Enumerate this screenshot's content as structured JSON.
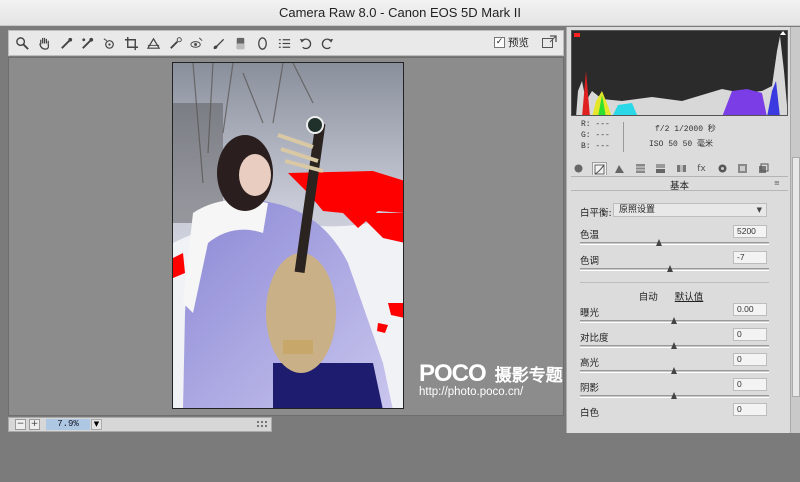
{
  "window": {
    "title": "Camera Raw 8.0 -  Canon EOS 5D Mark II"
  },
  "toolbar": {
    "tools": [
      {
        "name": "zoom-tool-icon"
      },
      {
        "name": "hand-tool-icon"
      },
      {
        "name": "white-balance-tool-icon"
      },
      {
        "name": "color-sampler-icon"
      },
      {
        "name": "targeted-adjustment-icon"
      },
      {
        "name": "crop-tool-icon"
      },
      {
        "name": "straighten-tool-icon"
      },
      {
        "name": "spot-removal-icon"
      },
      {
        "name": "red-eye-icon"
      },
      {
        "name": "adjustment-brush-icon"
      },
      {
        "name": "graduated-filter-icon"
      },
      {
        "name": "radial-filter-icon"
      },
      {
        "name": "preferences-icon"
      },
      {
        "name": "rotate-ccw-icon"
      },
      {
        "name": "rotate-cw-icon"
      }
    ],
    "preview_label": "预览",
    "preview_checked": true
  },
  "watermark": {
    "logo": "POCO",
    "cn_text": "摄影专题",
    "url": "http://photo.poco.cn/"
  },
  "statusbar": {
    "zoom": "7.9%",
    "minus": "−",
    "plus": "+"
  },
  "info": {
    "r": "R:  ---",
    "g": "G:  ---",
    "b": "B:  ---",
    "cam1": "f/2   1/2000 秒",
    "cam2": "ISO 50   50 毫米"
  },
  "tabs": [
    {
      "name": "tab-basic"
    },
    {
      "name": "tab-tone-curve"
    },
    {
      "name": "tab-detail"
    },
    {
      "name": "tab-hsl"
    },
    {
      "name": "tab-split-toning"
    },
    {
      "name": "tab-lens"
    },
    {
      "name": "tab-effects"
    },
    {
      "name": "tab-camera-calibration"
    },
    {
      "name": "tab-presets"
    },
    {
      "name": "tab-snapshots"
    }
  ],
  "tab_fx_label": "fx",
  "panel": {
    "title": "基本",
    "menu": "≡",
    "white_balance_label": "白平衡:",
    "white_balance_value": "原照设置",
    "temperature": {
      "label": "色温",
      "value": "5200",
      "level": 0.42
    },
    "tint": {
      "label": "色调",
      "value": "-7",
      "level": 0.48
    },
    "auto": "自动",
    "default": "默认值",
    "exposure": {
      "label": "曝光",
      "value": "0.00",
      "level": 0.5
    },
    "contrast": {
      "label": "对比度",
      "value": "0",
      "level": 0.5
    },
    "highlights": {
      "label": "高光",
      "value": "0",
      "level": 0.5
    },
    "shadows": {
      "label": "阴影",
      "value": "0",
      "level": 0.5
    },
    "whites": {
      "label": "白色",
      "value": "0",
      "level": 0.5
    }
  },
  "colors": {
    "clip_warning": "#ff0000",
    "zoom_bg": "#aec7e2"
  }
}
